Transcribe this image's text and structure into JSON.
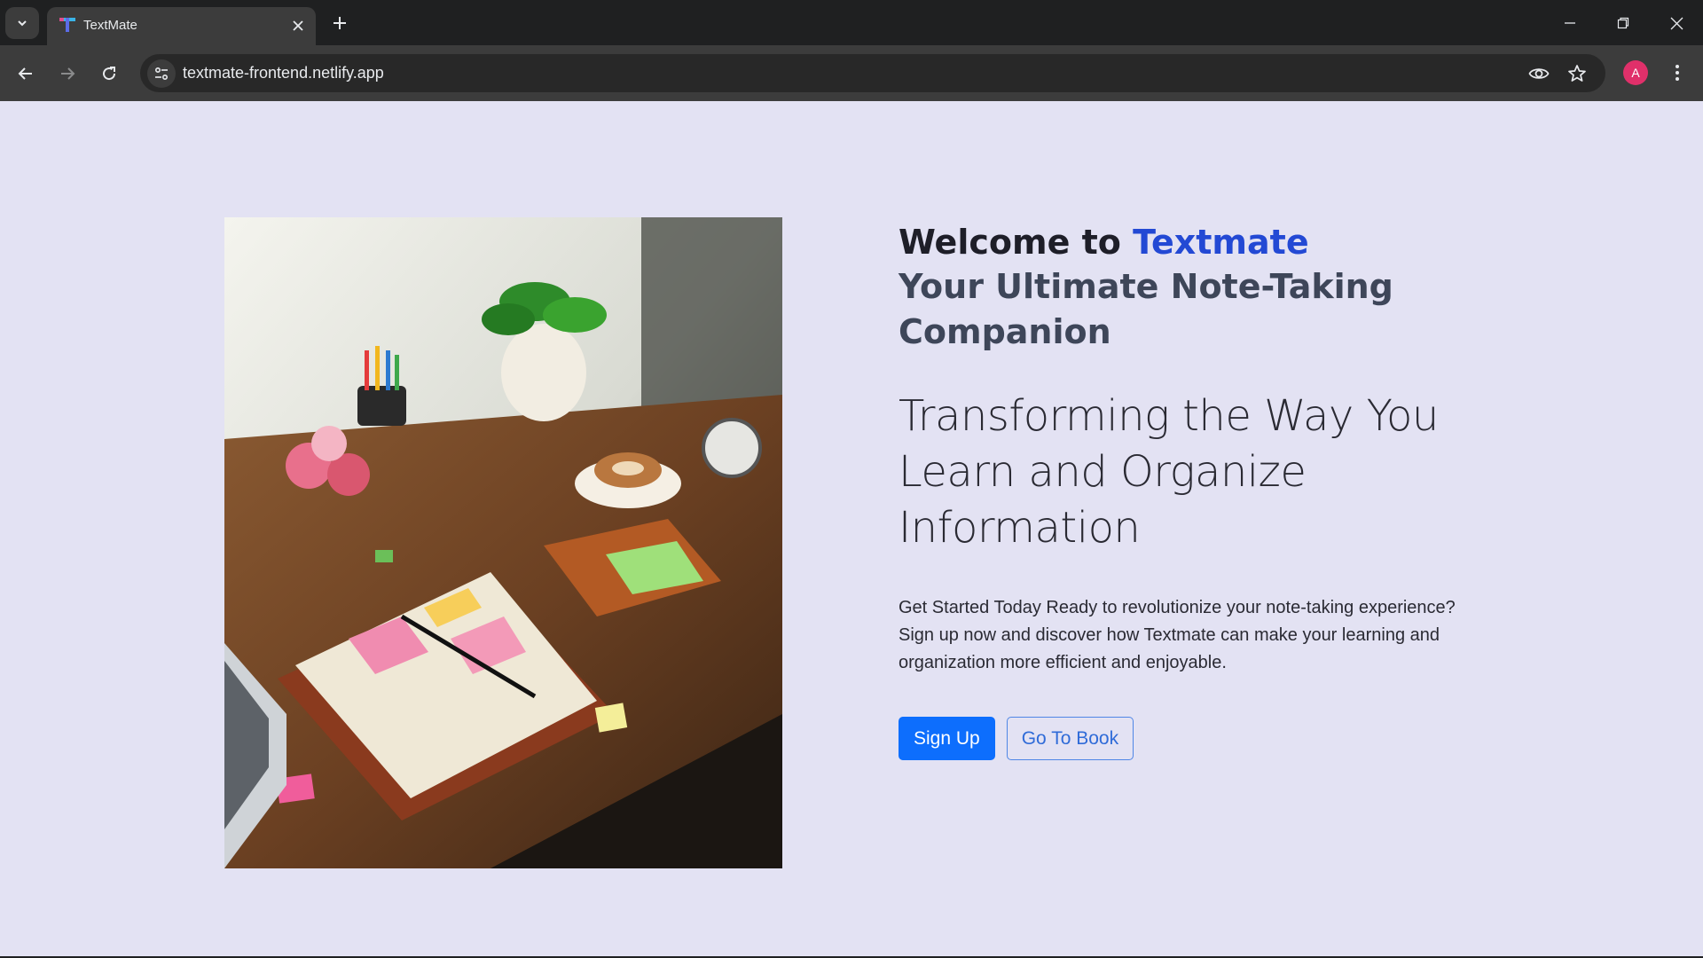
{
  "browser": {
    "tab_title": "TextMate",
    "url": "textmate-frontend.netlify.app",
    "profile_initial": "A"
  },
  "hero": {
    "welcome_prefix": "Welcome to ",
    "brand": "Textmate",
    "subtitle": "Your Ultimate Note-Taking Companion",
    "tagline": "Transforming the Way You Learn and Organize Information",
    "description": "Get Started Today Ready to revolutionize your note-taking experience? Sign up now and discover how Textmate can make your learning and organization more efficient and enjoyable.",
    "signup_label": "Sign Up",
    "gotobook_label": "Go To Book"
  },
  "colors": {
    "page_bg": "#e3e2f3",
    "brand": "#2349d4",
    "primary": "#0d6efd"
  },
  "icons": {
    "tab_search": "chevron-down-icon",
    "favicon": "textmate-favicon",
    "back": "arrow-left-icon",
    "forward": "arrow-right-icon",
    "reload": "reload-icon",
    "site_info": "tune-icon",
    "eye": "eye-icon",
    "bookmark": "star-icon",
    "menu": "kebab-menu-icon"
  }
}
